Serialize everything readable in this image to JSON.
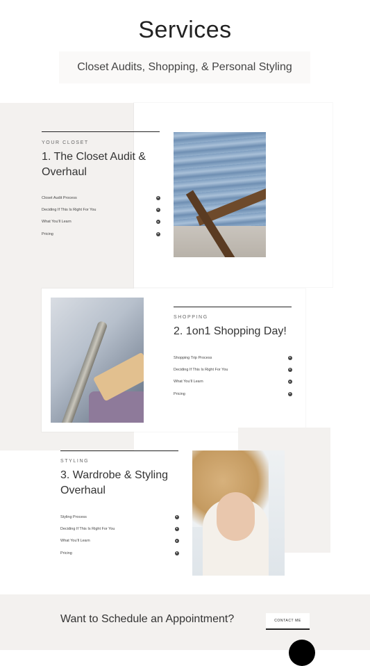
{
  "header": {
    "title": "Services",
    "subtitle": "Closet Audits, Shopping, & Personal Styling"
  },
  "sections": [
    {
      "eyebrow": "YOUR CLOSET",
      "heading_line1": "1. The Closet Audit &",
      "heading_line2": "Overhaul",
      "items": [
        "Closet Audit Process",
        "Deciding If This Is Right For You",
        "What You'll Learn",
        "Pricing"
      ]
    },
    {
      "eyebrow": "SHOPPING",
      "heading_line1": "2. 1on1 Shopping Day!",
      "items": [
        "Shopping Trip Process",
        "Deciding If This Is Right For You",
        "What You'll Learn",
        "Pricing"
      ]
    },
    {
      "eyebrow": "STYLING",
      "heading_line1": "3. Wardrobe & Styling",
      "heading_line2": "Overhaul",
      "items": [
        "Styling Process",
        "Deciding If This Is Right For You",
        "What You'll Learn",
        "Pricing"
      ]
    }
  ],
  "cta": {
    "text": "Want to Schedule an Appointment?",
    "button": "CONTACT ME"
  },
  "icons": {
    "list_toggle": "play-circle-icon",
    "chat": "chat-bubble-icon"
  }
}
